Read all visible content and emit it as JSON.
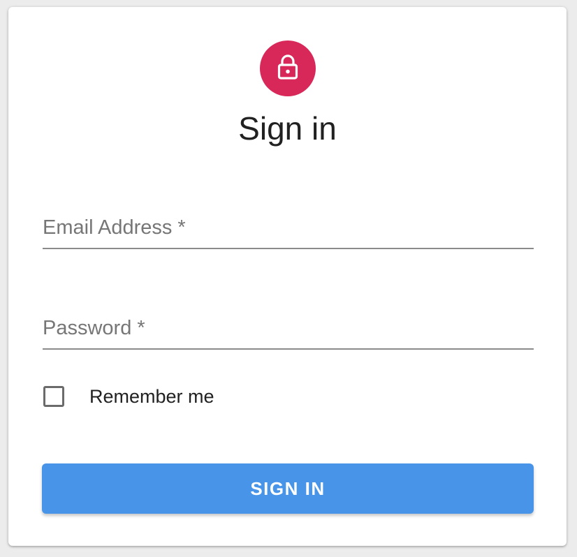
{
  "header": {
    "title": "Sign in",
    "icon": "lock-icon"
  },
  "form": {
    "email": {
      "label": "Email Address *",
      "value": ""
    },
    "password": {
      "label": "Password *",
      "value": ""
    },
    "remember": {
      "label": "Remember me",
      "checked": false
    },
    "submit_label": "SIGN IN"
  },
  "colors": {
    "avatar": "#d8285a",
    "button": "#4794e8",
    "background": "#ececec",
    "card": "#ffffff"
  }
}
